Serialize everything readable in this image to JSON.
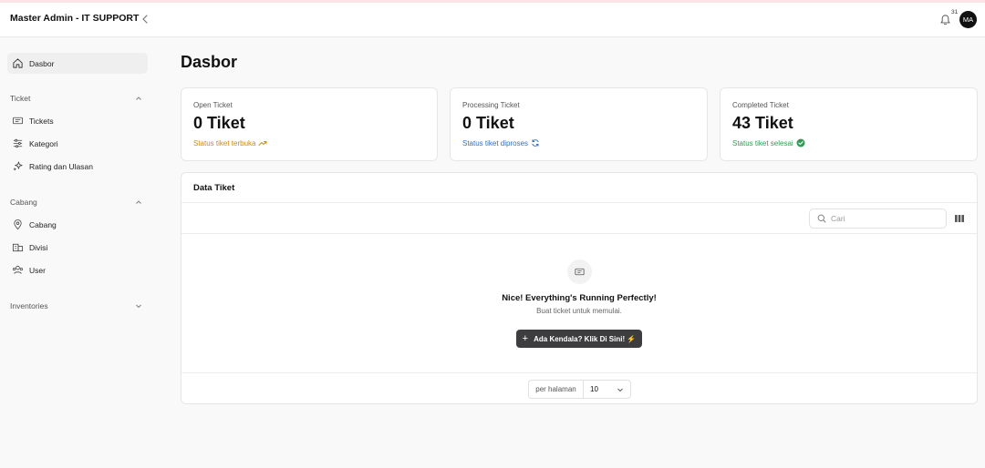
{
  "header": {
    "brand": "Master Admin - IT SUPPORT",
    "notification_count": "31",
    "avatar_initials": "MA"
  },
  "sidebar": {
    "dashboard": "Dasbor",
    "groups": [
      {
        "label": "Ticket",
        "expanded": true,
        "items": [
          "Tickets",
          "Kategori",
          "Rating dan Ulasan"
        ]
      },
      {
        "label": "Cabang",
        "expanded": true,
        "items": [
          "Cabang",
          "Divisi",
          "User"
        ]
      },
      {
        "label": "Inventories",
        "expanded": false,
        "items": []
      }
    ]
  },
  "page": {
    "title": "Dasbor"
  },
  "stats": [
    {
      "label": "Open Ticket",
      "value": "0 Tiket",
      "status": "Status tiket terbuka",
      "color": "#c98a12",
      "icon": "trending-up-icon"
    },
    {
      "label": "Processing Ticket",
      "value": "0 Tiket",
      "status": "Status tiket diproses",
      "color": "#2f6fbf",
      "icon": "refresh-icon"
    },
    {
      "label": "Completed Ticket",
      "value": "43 Tiket",
      "status": "Status tiket selesai",
      "color": "#2f9b54",
      "icon": "check-circle-icon"
    }
  ],
  "table": {
    "title": "Data Tiket",
    "search_placeholder": "Cari",
    "empty_title": "Nice! Everything's Running Perfectly!",
    "empty_subtitle": "Buat ticket untuk memulai.",
    "cta_label": "Ada Kendala? Klik Di Sini! ⚡",
    "per_page_label": "per halaman",
    "per_page_value": "10"
  }
}
